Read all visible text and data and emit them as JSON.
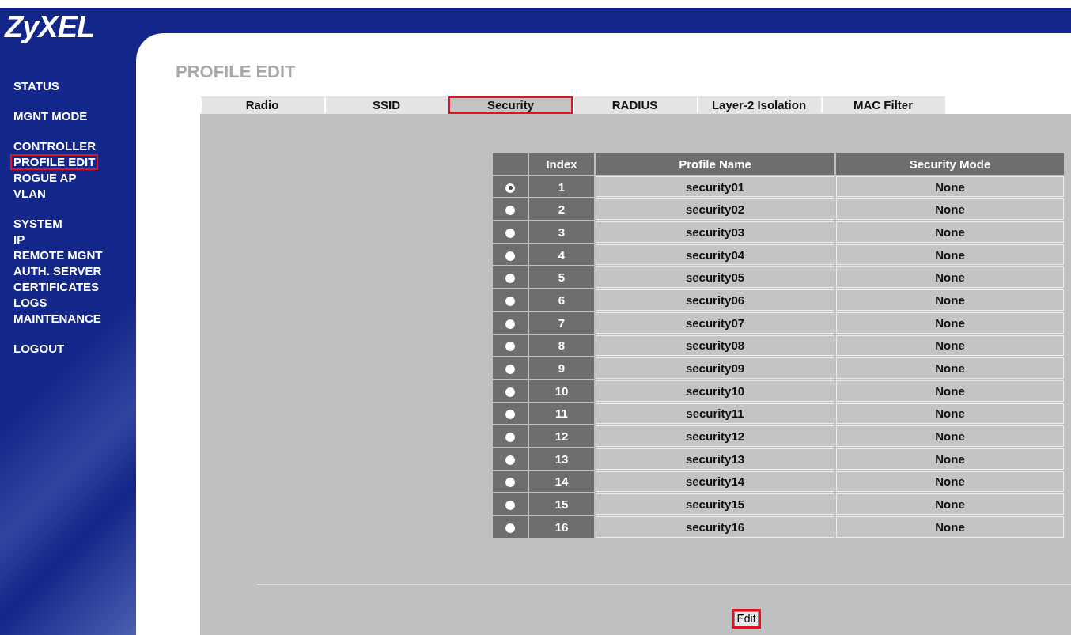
{
  "logo": "ZyXEL",
  "sidebar": {
    "groups": [
      {
        "items": [
          {
            "label": "STATUS",
            "selected": false
          }
        ]
      },
      {
        "items": [
          {
            "label": "MGNT MODE",
            "selected": false
          }
        ]
      },
      {
        "items": [
          {
            "label": "CONTROLLER",
            "selected": false
          },
          {
            "label": "PROFILE EDIT",
            "selected": true
          },
          {
            "label": "ROGUE AP",
            "selected": false
          },
          {
            "label": "VLAN",
            "selected": false
          }
        ]
      },
      {
        "items": [
          {
            "label": "SYSTEM",
            "selected": false
          },
          {
            "label": "IP",
            "selected": false
          },
          {
            "label": "REMOTE MGNT",
            "selected": false
          },
          {
            "label": "AUTH. SERVER",
            "selected": false
          },
          {
            "label": "CERTIFICATES",
            "selected": false
          },
          {
            "label": "LOGS",
            "selected": false
          },
          {
            "label": "MAINTENANCE",
            "selected": false
          }
        ]
      },
      {
        "items": [
          {
            "label": "LOGOUT",
            "selected": false
          }
        ]
      }
    ]
  },
  "page_title": "PROFILE EDIT",
  "tabs": [
    {
      "label": "Radio",
      "selected": false
    },
    {
      "label": "SSID",
      "selected": false
    },
    {
      "label": "Security",
      "selected": true
    },
    {
      "label": "RADIUS",
      "selected": false
    },
    {
      "label": "Layer-2 Isolation",
      "selected": false
    },
    {
      "label": "MAC Filter",
      "selected": false
    }
  ],
  "table": {
    "columns": [
      "Index",
      "Profile Name",
      "Security Mode"
    ],
    "rows": [
      {
        "selected": true,
        "index": "1",
        "name": "security01",
        "mode": "None"
      },
      {
        "selected": false,
        "index": "2",
        "name": "security02",
        "mode": "None"
      },
      {
        "selected": false,
        "index": "3",
        "name": "security03",
        "mode": "None"
      },
      {
        "selected": false,
        "index": "4",
        "name": "security04",
        "mode": "None"
      },
      {
        "selected": false,
        "index": "5",
        "name": "security05",
        "mode": "None"
      },
      {
        "selected": false,
        "index": "6",
        "name": "security06",
        "mode": "None"
      },
      {
        "selected": false,
        "index": "7",
        "name": "security07",
        "mode": "None"
      },
      {
        "selected": false,
        "index": "8",
        "name": "security08",
        "mode": "None"
      },
      {
        "selected": false,
        "index": "9",
        "name": "security09",
        "mode": "None"
      },
      {
        "selected": false,
        "index": "10",
        "name": "security10",
        "mode": "None"
      },
      {
        "selected": false,
        "index": "11",
        "name": "security11",
        "mode": "None"
      },
      {
        "selected": false,
        "index": "12",
        "name": "security12",
        "mode": "None"
      },
      {
        "selected": false,
        "index": "13",
        "name": "security13",
        "mode": "None"
      },
      {
        "selected": false,
        "index": "14",
        "name": "security14",
        "mode": "None"
      },
      {
        "selected": false,
        "index": "15",
        "name": "security15",
        "mode": "None"
      },
      {
        "selected": false,
        "index": "16",
        "name": "security16",
        "mode": "None"
      }
    ]
  },
  "edit_button": {
    "label": "Edit",
    "highlighted": true
  }
}
